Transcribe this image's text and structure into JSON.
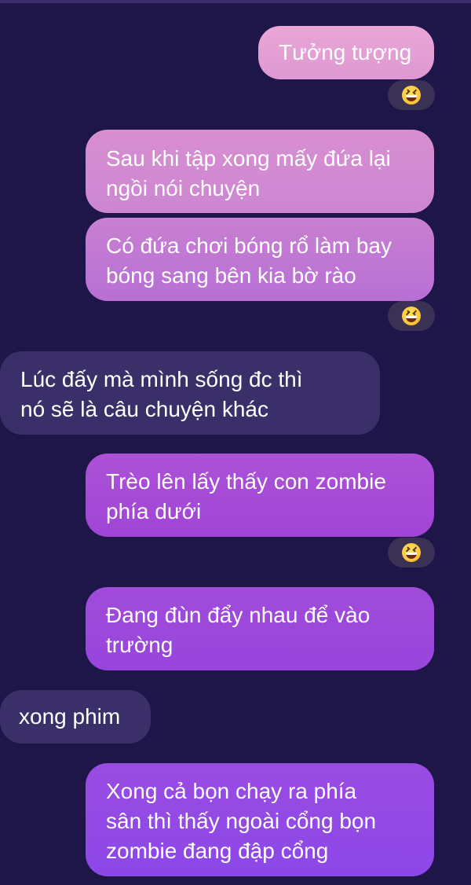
{
  "messages": [
    {
      "side": "out",
      "text": "Tưởng tượng"
    },
    {
      "side": "out",
      "text": "Sau khi tập xong mấy đứa lại\nngồi nói chuyện"
    },
    {
      "side": "out",
      "text": "Có đứa chơi bóng rổ làm bay\nbóng sang bên kia bờ rào"
    },
    {
      "side": "in",
      "text": "Lúc đấy mà mình sống đc thì\nnó sẽ là câu chuyện khác"
    },
    {
      "side": "out",
      "text": "Trèo lên lấy thấy con zombie\nphía dưới"
    },
    {
      "side": "out",
      "text": "Đang đùn đẩy nhau để vào\ntrường"
    },
    {
      "side": "in",
      "text": "xong phim"
    },
    {
      "side": "out",
      "text": "Xong cả bọn chạy ra phía\nsân thì thấy ngoài cổng bọn\nzombie đang đập cổng"
    }
  ],
  "reactions": [
    {
      "after_message": 1,
      "emoji": "grinning-squinting-face-icon"
    },
    {
      "after_message": 3,
      "emoji": "grinning-squinting-face-icon"
    },
    {
      "after_message": 5,
      "emoji": "grinning-squinting-face-icon"
    }
  ],
  "colors": {
    "background": "#1e1548",
    "incoming_bubble": "#3b2f6a",
    "outgoing_gradient_top": "#e59bd0",
    "outgoing_gradient_bottom": "#8a45e8",
    "reaction_pill": "#3a3155"
  }
}
